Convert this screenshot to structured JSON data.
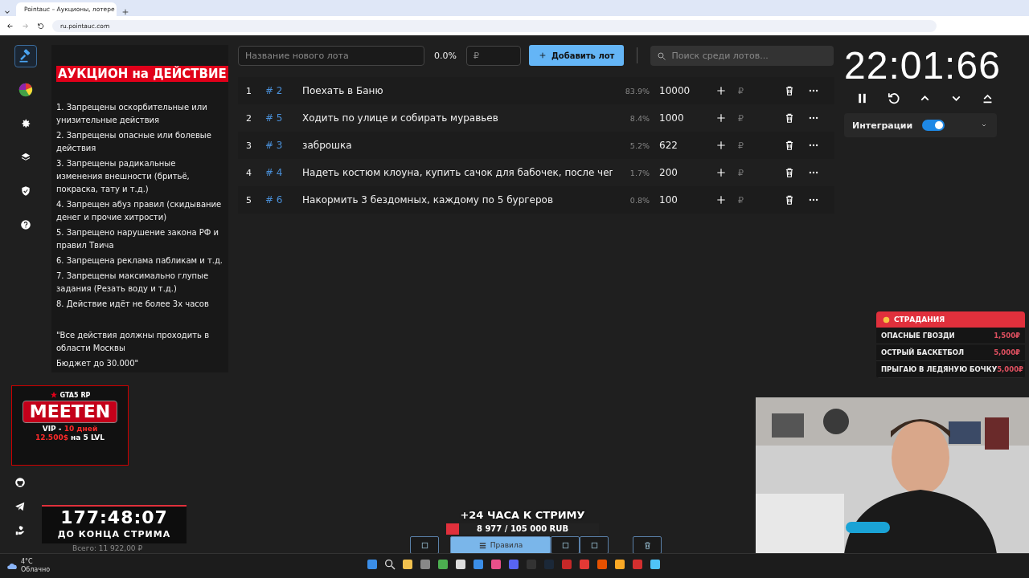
{
  "browser": {
    "tab_title": "Pointauc – Аукционы, лотере",
    "url": "ru.pointauc.com"
  },
  "sidebar": {
    "items": [
      {
        "selected": true
      },
      {
        "selected": false
      },
      {
        "selected": false
      },
      {
        "selected": false
      },
      {
        "selected": false
      },
      {
        "selected": false
      }
    ]
  },
  "rules": {
    "title": "АУКЦИОН на ДЕЙСТВИЕ",
    "lines": [
      "1. Запрещены оскорбительные или унизительные действия",
      "2. Запрещены опасные или болевые действия",
      "3. Запрещены радикальные изменения внешности (бритьё, покраска, тату и т.д.)",
      "4. Запрещен абуз правил (скидывание денег и прочие хитрости)",
      "5. Запрещено нарушение закона РФ и правил Твича",
      "6. Запрещена реклама пабликам и т.д.",
      "7.  Запрещены максимально глупые задания (Резать воду и т.д.)",
      "8. Действие идёт не более 3х часов"
    ],
    "note_lines": [
      "\"Все действия должны проходить в области Москвы",
      "Бюджет до 30.000\""
    ]
  },
  "toolbar": {
    "name_placeholder": "Название нового лота",
    "percent": "0.0%",
    "amount_placeholder": "₽",
    "add_button": "Добавить лот",
    "search_placeholder": "Поиск среди лотов..."
  },
  "lots": [
    {
      "index": "1",
      "id": "# 2",
      "name": "Поехать в Баню",
      "percent": "83.9%",
      "amount": "10000",
      "currency": "₽"
    },
    {
      "index": "2",
      "id": "# 5",
      "name": "Ходить по улице и собирать муравьев",
      "percent": "8.4%",
      "amount": "1000",
      "currency": "₽"
    },
    {
      "index": "3",
      "id": "# 3",
      "name": "заброшка",
      "percent": "5.2%",
      "amount": "622",
      "currency": "₽"
    },
    {
      "index": "4",
      "id": "# 4",
      "name": "Надеть костюм клоуна, купить сачок для бабочек, после чег",
      "percent": "1.7%",
      "amount": "200",
      "currency": "₽"
    },
    {
      "index": "5",
      "id": "# 6",
      "name": "Накормить 3 бездомных, каждому по 5 бургеров",
      "percent": "0.8%",
      "amount": "100",
      "currency": "₽"
    }
  ],
  "timer": {
    "time": "22:01:66",
    "integrations_label": "Интеграции",
    "integrations_on": true
  },
  "suffering": {
    "title": "СТРАДАНИЯ",
    "items": [
      {
        "name": "ОПАСНЫЕ ГВОЗДИ",
        "price": "1,500₽"
      },
      {
        "name": "ОСТРЫЙ БАСКЕТБОЛ",
        "price": "5,000₽"
      },
      {
        "name": "ПРЫГАЮ В ЛЕДЯНУЮ БОЧКУ",
        "price": "5,000₽"
      }
    ]
  },
  "promo": {
    "brand": "GTA5 RP",
    "title": "MEETEN",
    "line1": "VIP - ",
    "line1_accent": "10 дней",
    "line2_accent": "12.500$",
    "line2": " на 5 LVL"
  },
  "stream_timer": {
    "time": "177:48:07",
    "label": "ДО КОНЦА СТРИМА"
  },
  "total": "Всего: 11 922,00 ₽",
  "goal": {
    "title": "+24 ЧАСА К СТРИМУ",
    "progress": "8 977 / 105 000 RUB",
    "level": 0.085
  },
  "bottom_buttons": [
    {
      "kind": "icon"
    },
    {
      "kind": "label",
      "label": "Правила"
    },
    {
      "kind": "icon"
    },
    {
      "kind": "icon"
    },
    {
      "kind": "icon"
    }
  ],
  "weather": {
    "temp": "4°C",
    "condition": "Облачно"
  }
}
